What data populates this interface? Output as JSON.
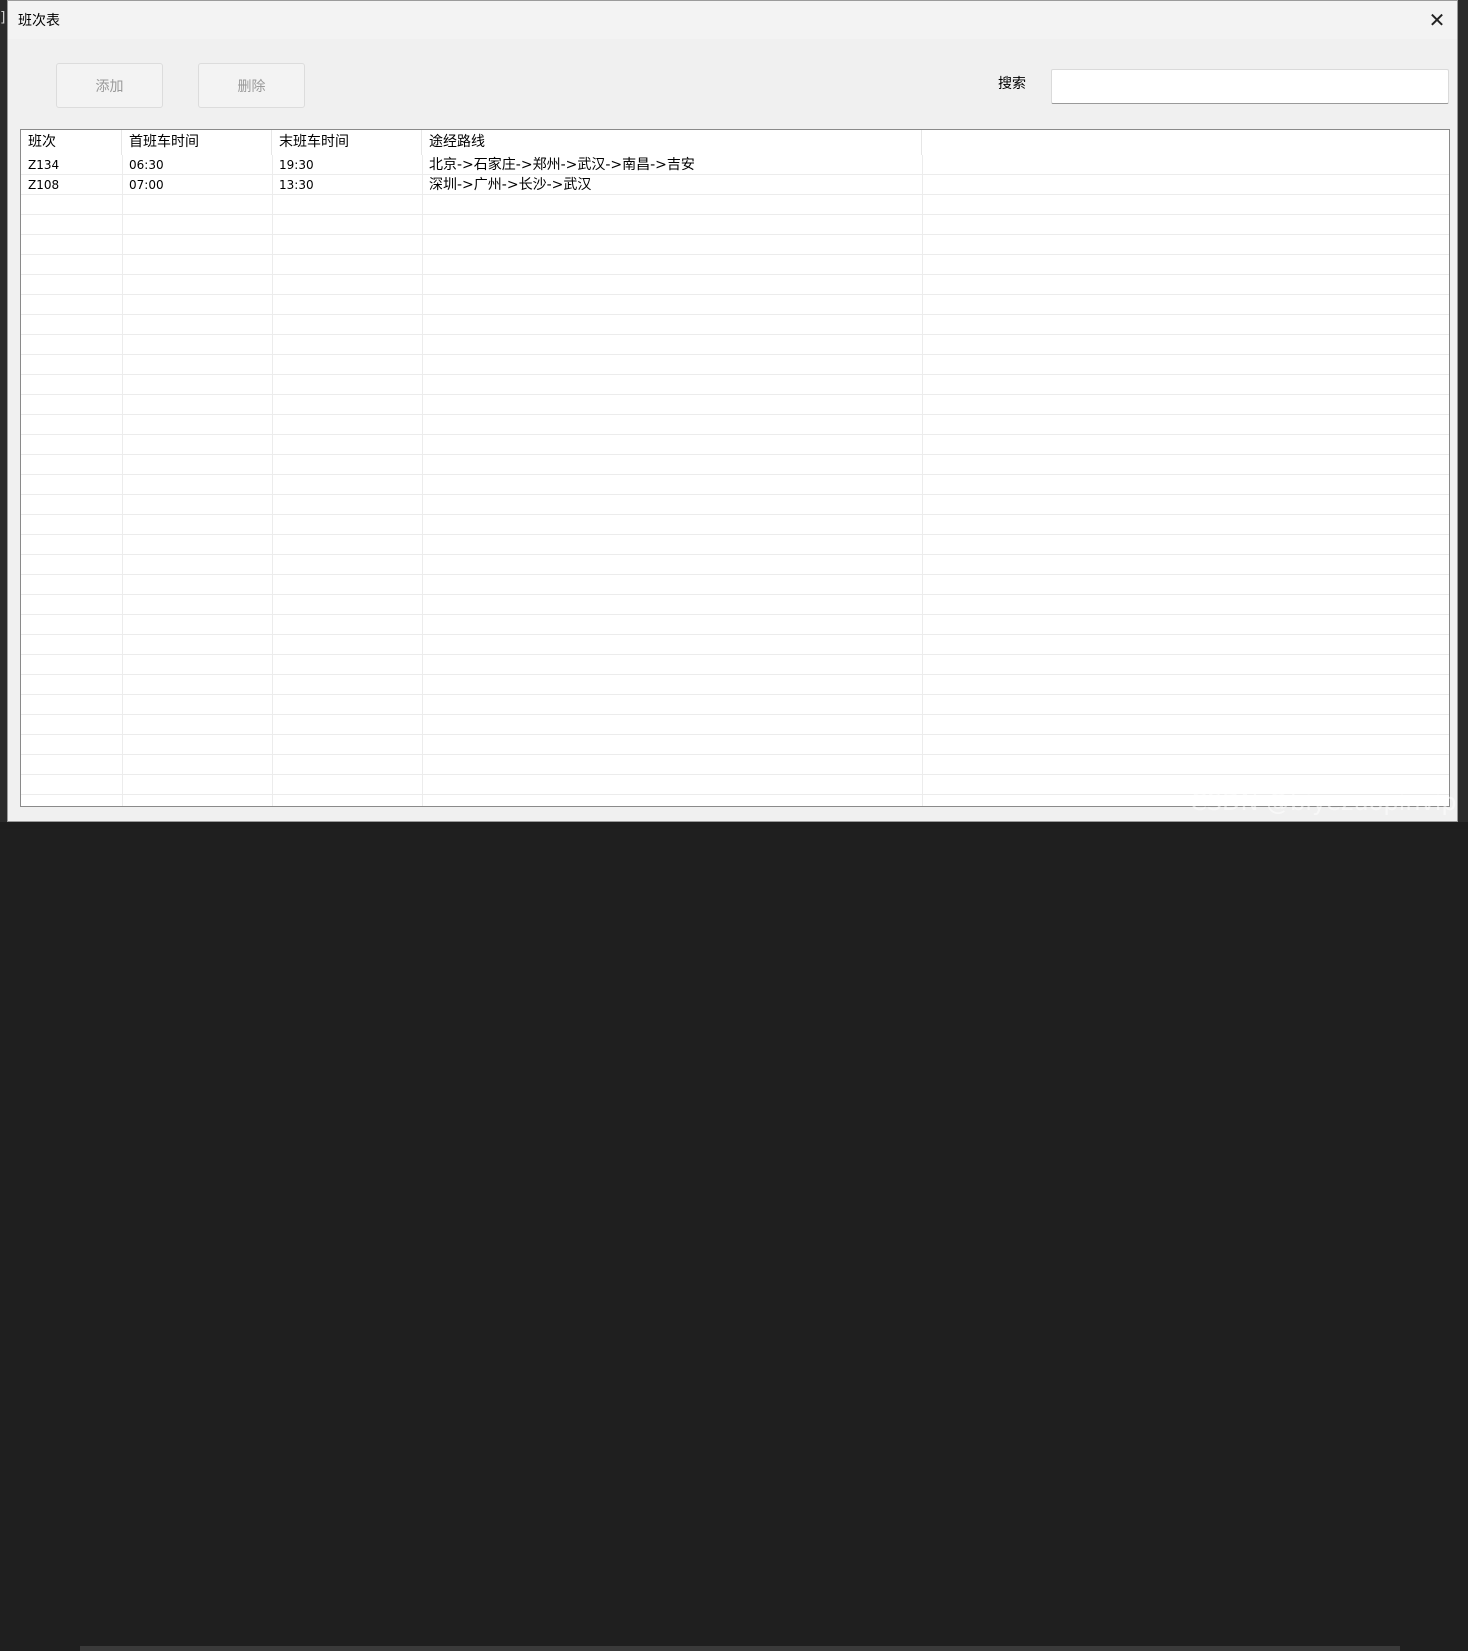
{
  "window": {
    "title": "班次表"
  },
  "toolbar": {
    "add_label": "添加",
    "delete_label": "删除",
    "search_label": "搜索",
    "search_value": ""
  },
  "table": {
    "columns": [
      "班次",
      "首班车时间",
      "末班车时间",
      "途经路线"
    ],
    "rows": [
      {
        "train": "Z134",
        "first": "06:30",
        "last": "19:30",
        "route": "北京->石家庄->郑州->武汉->南昌->吉安"
      },
      {
        "train": "Z108",
        "first": "07:00",
        "last": "13:30",
        "route": "深圳->广州->长沙->武汉"
      }
    ]
  },
  "watermark": "CSDN @biyezuopinvip"
}
